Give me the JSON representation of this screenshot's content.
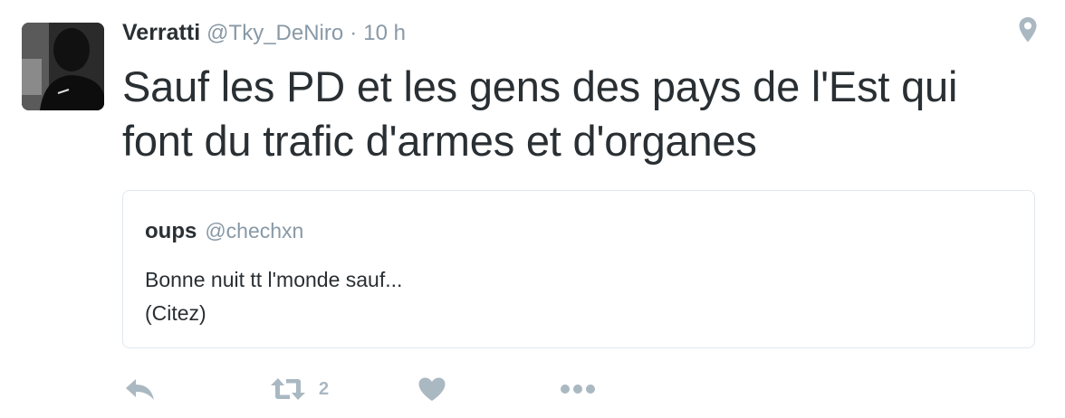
{
  "tweet": {
    "display_name": "Verratti",
    "handle": "@Tky_DeNiro",
    "separator": "·",
    "time": "10 h",
    "text": "Sauf les PD et les gens des pays de l'Est qui font du trafic d'armes et d'organes",
    "quoted": {
      "display_name": "oups",
      "handle": "@chechxn",
      "text": "Bonne nuit tt l'monde sauf...\n(Citez)"
    },
    "actions": {
      "reply_icon": "reply-icon",
      "retweet_icon": "retweet-icon",
      "retweet_count": "2",
      "like_icon": "heart-icon",
      "more_icon": "more-icon"
    },
    "colors": {
      "text": "#292f33",
      "secondary": "#8899a6",
      "icon": "#aab8c2",
      "border": "#e1e8ed"
    }
  }
}
